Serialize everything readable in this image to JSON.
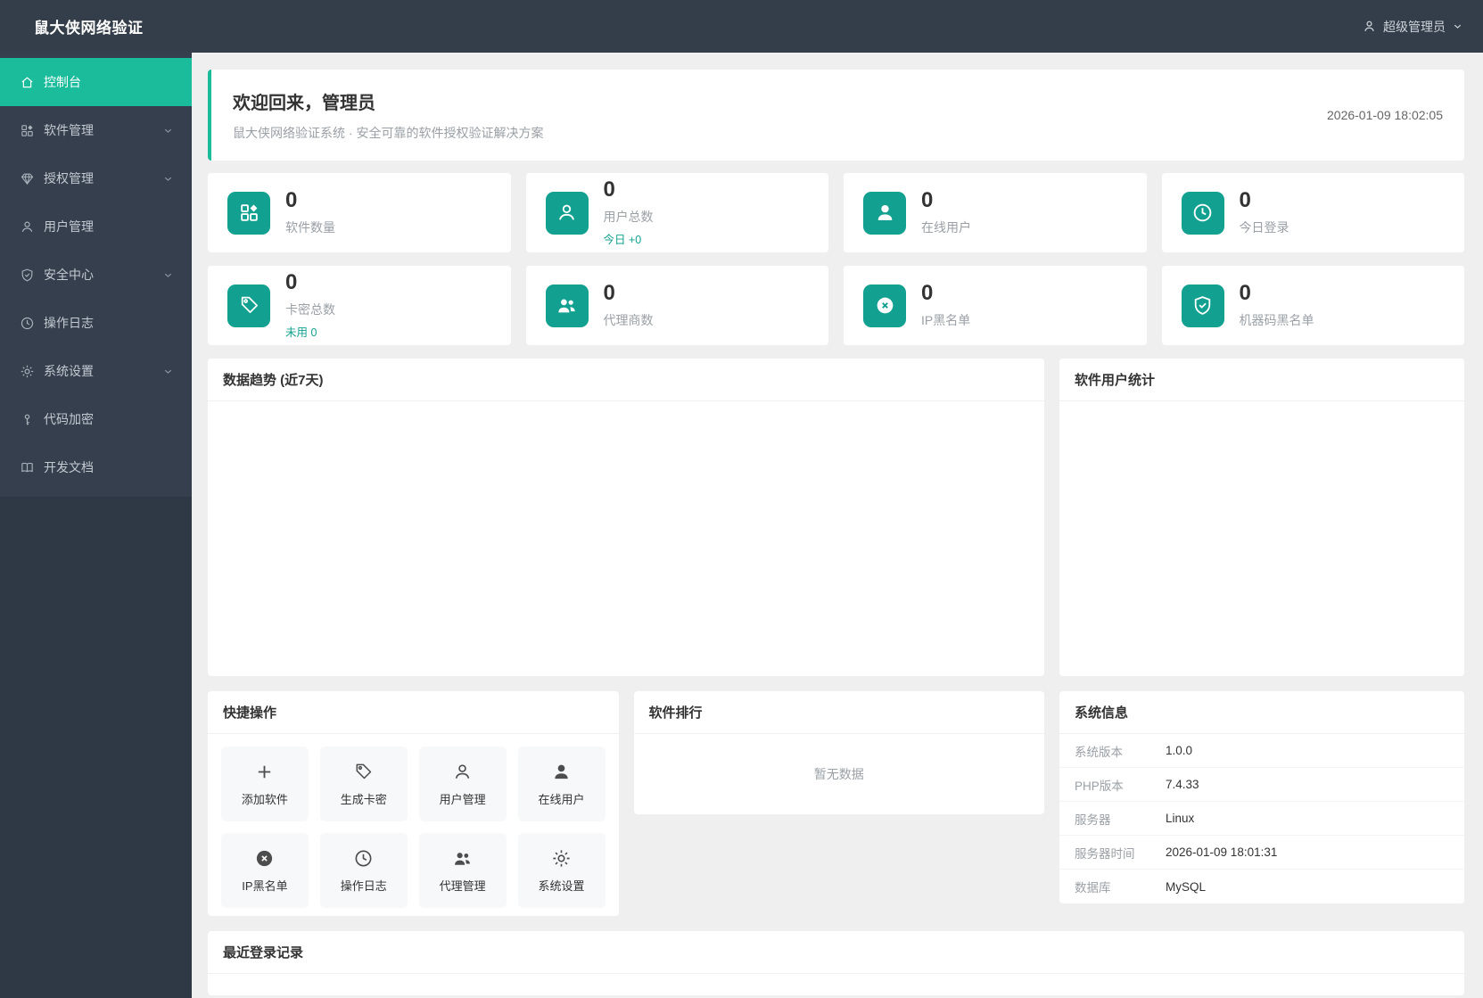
{
  "app": {
    "title": "鼠大侠网络验证"
  },
  "header": {
    "user_label": "超级管理员"
  },
  "colors": {
    "accent": "#1abc9c",
    "icon_teal": "#12a190",
    "header_bg": "#343e4a",
    "sidebar_bg": "#353f4d"
  },
  "sidebar": {
    "items": [
      {
        "label": "控制台",
        "icon": "home-icon",
        "active": true,
        "has_chevron": false
      },
      {
        "label": "软件管理",
        "icon": "apps-icon",
        "active": false,
        "has_chevron": true
      },
      {
        "label": "授权管理",
        "icon": "gem-icon",
        "active": false,
        "has_chevron": true
      },
      {
        "label": "用户管理",
        "icon": "user-icon",
        "active": false,
        "has_chevron": false
      },
      {
        "label": "安全中心",
        "icon": "shield-check-icon",
        "active": false,
        "has_chevron": true
      },
      {
        "label": "操作日志",
        "icon": "clock-icon",
        "active": false,
        "has_chevron": false
      },
      {
        "label": "系统设置",
        "icon": "gear-icon",
        "active": false,
        "has_chevron": true
      },
      {
        "label": "代码加密",
        "icon": "key-icon",
        "active": false,
        "has_chevron": false
      },
      {
        "label": "开发文档",
        "icon": "book-icon",
        "active": false,
        "has_chevron": false
      }
    ]
  },
  "welcome": {
    "title": "欢迎回来，管理员",
    "subtitle": "鼠大侠网络验证系统 · 安全可靠的软件授权验证解决方案",
    "timestamp": "2026-01-09 18:02:05"
  },
  "stats": [
    {
      "value": "0",
      "label": "软件数量",
      "icon": "apps-icon",
      "sub": ""
    },
    {
      "value": "0",
      "label": "用户总数",
      "icon": "user-icon",
      "sub": "今日 +0"
    },
    {
      "value": "0",
      "label": "在线用户",
      "icon": "user-filled-icon",
      "sub": ""
    },
    {
      "value": "0",
      "label": "今日登录",
      "icon": "clock-icon",
      "sub": ""
    },
    {
      "value": "0",
      "label": "卡密总数",
      "icon": "tag-icon",
      "sub": "未用 0"
    },
    {
      "value": "0",
      "label": "代理商数",
      "icon": "users-icon",
      "sub": ""
    },
    {
      "value": "0",
      "label": "IP黑名单",
      "icon": "circle-x-icon",
      "sub": ""
    },
    {
      "value": "0",
      "label": "机器码黑名单",
      "icon": "shield-check-icon",
      "sub": ""
    }
  ],
  "panels": {
    "trend": {
      "title": "数据趋势 (近7天)"
    },
    "user_stats": {
      "title": "软件用户统计"
    },
    "quick": {
      "title": "快捷操作",
      "actions": [
        {
          "label": "添加软件",
          "icon": "plus-icon"
        },
        {
          "label": "生成卡密",
          "icon": "tag-icon"
        },
        {
          "label": "用户管理",
          "icon": "user-icon"
        },
        {
          "label": "在线用户",
          "icon": "user-filled-icon"
        },
        {
          "label": "IP黑名单",
          "icon": "circle-x-icon"
        },
        {
          "label": "操作日志",
          "icon": "clock-icon"
        },
        {
          "label": "代理管理",
          "icon": "users-icon"
        },
        {
          "label": "系统设置",
          "icon": "gear-icon"
        }
      ]
    },
    "ranking": {
      "title": "软件排行",
      "empty_text": "暂无数据"
    },
    "system_info": {
      "title": "系统信息",
      "rows": [
        {
          "label": "系统版本",
          "value": "1.0.0"
        },
        {
          "label": "PHP版本",
          "value": "7.4.33"
        },
        {
          "label": "服务器",
          "value": "Linux"
        },
        {
          "label": "服务器时间",
          "value": "2026-01-09 18:01:31"
        },
        {
          "label": "数据库",
          "value": "MySQL"
        }
      ]
    },
    "recent_logins": {
      "title": "最近登录记录"
    }
  }
}
